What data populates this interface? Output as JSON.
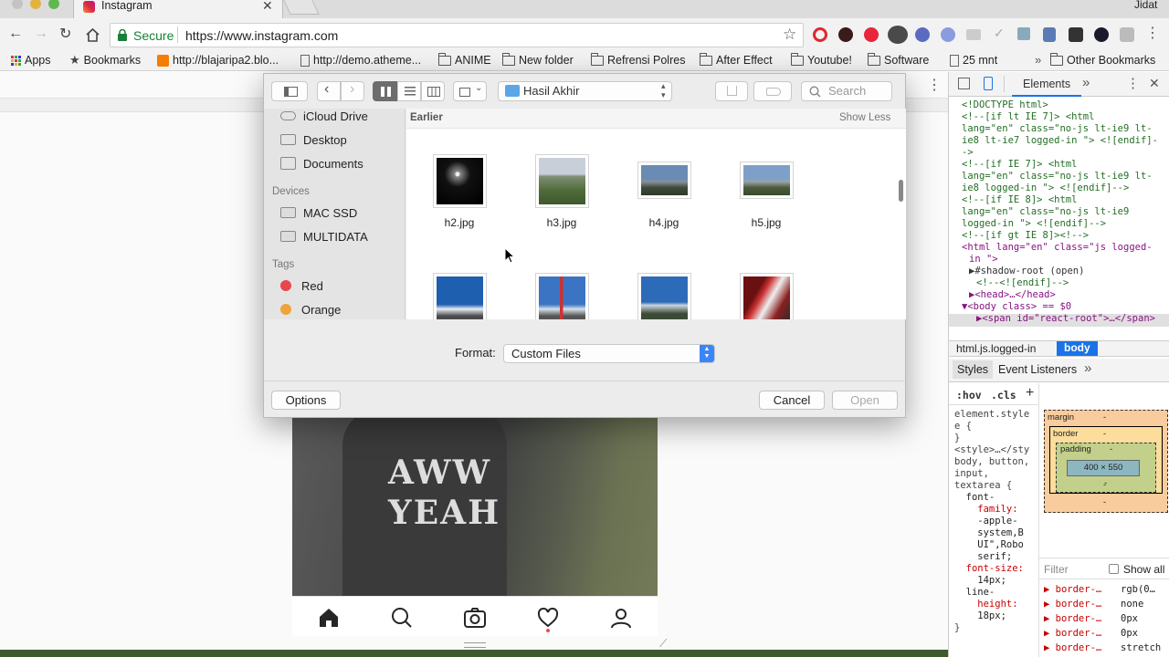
{
  "browser": {
    "tab_title": "Instagram",
    "user_name": "Jidat",
    "secure_label": "Secure",
    "url": "https://www.instagram.com",
    "bookmarks": {
      "apps": "Apps",
      "bookmarks": "Bookmarks",
      "items": [
        "http://blajaripa2.blo...",
        "http://demo.atheme...",
        "ANIME",
        "New folder",
        "Refrensi Polres",
        "After Effect",
        "Youtube!",
        "Software",
        "25 mnt"
      ],
      "other": "Other Bookmarks"
    }
  },
  "dialog": {
    "location": "Hasil Akhir",
    "search_placeholder": "Search",
    "sidebar": {
      "favorites": [
        "iCloud Drive",
        "Desktop",
        "Documents"
      ],
      "devices_header": "Devices",
      "devices": [
        "MAC SSD",
        "MULTIDATA"
      ],
      "tags_header": "Tags",
      "tags": [
        {
          "label": "Red",
          "color": "#e8474c"
        },
        {
          "label": "Orange",
          "color": "#f0a33a"
        }
      ]
    },
    "section_label": "Earlier",
    "show_less": "Show Less",
    "files_row1": [
      "h2.jpg",
      "h3.jpg",
      "h4.jpg",
      "h5.jpg"
    ],
    "format_label": "Format:",
    "format_value": "Custom Files",
    "options_button": "Options",
    "cancel_button": "Cancel",
    "open_button": "Open"
  },
  "instagram": {
    "shirt_text": "AWW YEAH"
  },
  "devtools": {
    "elements_tab": "Elements",
    "code_lines": [
      {
        "t": "<!DOCTYPE html>",
        "c": "cmt",
        "indent": 0
      },
      {
        "t": "<!--[if lt IE 7]>      <html",
        "c": "cmt",
        "indent": 0
      },
      {
        "t": "lang=\"en\" class=\"no-js lt-ie9 lt-",
        "c": "cmt",
        "indent": 0
      },
      {
        "t": "ie8 lt-ie7 logged-in \"> <![endif]-",
        "c": "cmt",
        "indent": 0
      },
      {
        "t": "->",
        "c": "cmt",
        "indent": 0
      },
      {
        "t": "<!--[if IE 7]>         <html",
        "c": "cmt",
        "indent": 0
      },
      {
        "t": "lang=\"en\" class=\"no-js lt-ie9 lt-",
        "c": "cmt",
        "indent": 0
      },
      {
        "t": "ie8 logged-in \"> <![endif]-->",
        "c": "cmt",
        "indent": 0
      },
      {
        "t": "<!--[if IE 8]>         <html",
        "c": "cmt",
        "indent": 0
      },
      {
        "t": "lang=\"en\" class=\"no-js lt-ie9",
        "c": "cmt",
        "indent": 0
      },
      {
        "t": "logged-in \"> <![endif]-->",
        "c": "cmt",
        "indent": 0
      },
      {
        "t": "<!--[if gt IE 8]><!-->",
        "c": "cmt",
        "indent": 0
      },
      {
        "t": "<html lang=\"en\" class=\"js logged-",
        "c": "tag",
        "indent": 0
      },
      {
        "t": "in \">",
        "c": "tag",
        "indent": 1
      },
      {
        "t": "▶#shadow-root (open)",
        "c": "plain",
        "indent": 1
      },
      {
        "t": "<!--<![endif]-->",
        "c": "cmt",
        "indent": 2
      },
      {
        "t": "▶<head>…</head>",
        "c": "tag",
        "indent": 1
      },
      {
        "t": "▼<body class> == $0",
        "c": "tag",
        "indent": 0
      },
      {
        "t": "▶<span id=\"react-root\">…</span>",
        "c": "tag",
        "indent": 2
      }
    ],
    "breadcrumb": [
      "html.js.logged-in",
      "body"
    ],
    "subtabs": [
      "Styles",
      "Event Listeners"
    ],
    "hov": ":hov",
    "cls": ".cls",
    "styles_lines": [
      "element.style",
      "e {",
      "}",
      "<style>…</sty",
      "body, button,",
      "input,",
      "textarea {",
      "  font-",
      "    family:",
      "    -apple-",
      "    system,B",
      "    UI\",Robo",
      "    serif;",
      "  font-size:",
      "    14px;",
      "  line-",
      "    height:",
      "    18px;",
      "}"
    ],
    "box_model": {
      "margin": "margin",
      "border": "border",
      "padding": "padding",
      "size": "400 × 550",
      "dash": "-"
    },
    "filter_placeholder": "Filter",
    "show_all": "Show all",
    "computed": [
      {
        "prop": "border-…",
        "val": "rgb(0…"
      },
      {
        "prop": "border-…",
        "val": "none"
      },
      {
        "prop": "border-…",
        "val": "0px"
      },
      {
        "prop": "border-…",
        "val": "0px"
      },
      {
        "prop": "border-…",
        "val": "stretch"
      }
    ]
  }
}
